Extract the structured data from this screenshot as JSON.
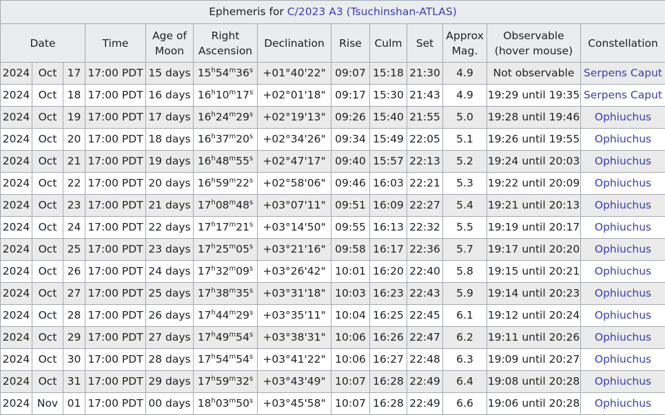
{
  "caption": {
    "prefix": "Ephemeris for ",
    "link": "C/2023 A3 (Tsuchinshan-ATLAS)"
  },
  "headers": {
    "date": "Date",
    "time": "Time",
    "age": [
      "Age of",
      "Moon"
    ],
    "ra": [
      "Right",
      "Ascension"
    ],
    "dec": "Declination",
    "rise": "Rise",
    "culm": "Culm",
    "set": "Set",
    "mag": [
      "Approx",
      "Mag."
    ],
    "obs": [
      "Observable",
      "(hover mouse)"
    ],
    "constellation": "Constellation"
  },
  "rows": [
    {
      "year": "2024",
      "month": "Oct",
      "day": "17",
      "time": "17:00 PDT",
      "age": "15 days",
      "ra": [
        "15",
        "54",
        "36"
      ],
      "dec": "+01°40'22\"",
      "rise": "09:07",
      "culm": "15:18",
      "set": "21:30",
      "mag": "4.9",
      "obs": "Not observable",
      "constellation": "Serpens Caput"
    },
    {
      "year": "2024",
      "month": "Oct",
      "day": "18",
      "time": "17:00 PDT",
      "age": "16 days",
      "ra": [
        "16",
        "10",
        "17"
      ],
      "dec": "+02°01'18\"",
      "rise": "09:17",
      "culm": "15:30",
      "set": "21:43",
      "mag": "4.9",
      "obs": "19:29 until 19:35",
      "constellation": "Serpens Caput"
    },
    {
      "year": "2024",
      "month": "Oct",
      "day": "19",
      "time": "17:00 PDT",
      "age": "17 days",
      "ra": [
        "16",
        "24",
        "29"
      ],
      "dec": "+02°19'13\"",
      "rise": "09:26",
      "culm": "15:40",
      "set": "21:55",
      "mag": "5.0",
      "obs": "19:28 until 19:46",
      "constellation": "Ophiuchus"
    },
    {
      "year": "2024",
      "month": "Oct",
      "day": "20",
      "time": "17:00 PDT",
      "age": "18 days",
      "ra": [
        "16",
        "37",
        "20"
      ],
      "dec": "+02°34'26\"",
      "rise": "09:34",
      "culm": "15:49",
      "set": "22:05",
      "mag": "5.1",
      "obs": "19:26 until 19:55",
      "constellation": "Ophiuchus"
    },
    {
      "year": "2024",
      "month": "Oct",
      "day": "21",
      "time": "17:00 PDT",
      "age": "19 days",
      "ra": [
        "16",
        "48",
        "55"
      ],
      "dec": "+02°47'17\"",
      "rise": "09:40",
      "culm": "15:57",
      "set": "22:13",
      "mag": "5.2",
      "obs": "19:24 until 20:03",
      "constellation": "Ophiuchus"
    },
    {
      "year": "2024",
      "month": "Oct",
      "day": "22",
      "time": "17:00 PDT",
      "age": "20 days",
      "ra": [
        "16",
        "59",
        "22"
      ],
      "dec": "+02°58'06\"",
      "rise": "09:46",
      "culm": "16:03",
      "set": "22:21",
      "mag": "5.3",
      "obs": "19:22 until 20:09",
      "constellation": "Ophiuchus"
    },
    {
      "year": "2024",
      "month": "Oct",
      "day": "23",
      "time": "17:00 PDT",
      "age": "21 days",
      "ra": [
        "17",
        "08",
        "48"
      ],
      "dec": "+03°07'11\"",
      "rise": "09:51",
      "culm": "16:09",
      "set": "22:27",
      "mag": "5.4",
      "obs": "19:21 until 20:13",
      "constellation": "Ophiuchus"
    },
    {
      "year": "2024",
      "month": "Oct",
      "day": "24",
      "time": "17:00 PDT",
      "age": "22 days",
      "ra": [
        "17",
        "17",
        "21"
      ],
      "dec": "+03°14'50\"",
      "rise": "09:55",
      "culm": "16:13",
      "set": "22:32",
      "mag": "5.5",
      "obs": "19:19 until 20:17",
      "constellation": "Ophiuchus"
    },
    {
      "year": "2024",
      "month": "Oct",
      "day": "25",
      "time": "17:00 PDT",
      "age": "23 days",
      "ra": [
        "17",
        "25",
        "05"
      ],
      "dec": "+03°21'16\"",
      "rise": "09:58",
      "culm": "16:17",
      "set": "22:36",
      "mag": "5.7",
      "obs": "19:17 until 20:20",
      "constellation": "Ophiuchus"
    },
    {
      "year": "2024",
      "month": "Oct",
      "day": "26",
      "time": "17:00 PDT",
      "age": "24 days",
      "ra": [
        "17",
        "32",
        "09"
      ],
      "dec": "+03°26'42\"",
      "rise": "10:01",
      "culm": "16:20",
      "set": "22:40",
      "mag": "5.8",
      "obs": "19:15 until 20:21",
      "constellation": "Ophiuchus"
    },
    {
      "year": "2024",
      "month": "Oct",
      "day": "27",
      "time": "17:00 PDT",
      "age": "25 days",
      "ra": [
        "17",
        "38",
        "35"
      ],
      "dec": "+03°31'18\"",
      "rise": "10:03",
      "culm": "16:23",
      "set": "22:43",
      "mag": "5.9",
      "obs": "19:14 until 20:23",
      "constellation": "Ophiuchus"
    },
    {
      "year": "2024",
      "month": "Oct",
      "day": "28",
      "time": "17:00 PDT",
      "age": "26 days",
      "ra": [
        "17",
        "44",
        "29"
      ],
      "dec": "+03°35'11\"",
      "rise": "10:04",
      "culm": "16:25",
      "set": "22:45",
      "mag": "6.1",
      "obs": "19:12 until 20:24",
      "constellation": "Ophiuchus"
    },
    {
      "year": "2024",
      "month": "Oct",
      "day": "29",
      "time": "17:00 PDT",
      "age": "27 days",
      "ra": [
        "17",
        "49",
        "54"
      ],
      "dec": "+03°38'31\"",
      "rise": "10:06",
      "culm": "16:26",
      "set": "22:47",
      "mag": "6.2",
      "obs": "19:11 until 20:26",
      "constellation": "Ophiuchus"
    },
    {
      "year": "2024",
      "month": "Oct",
      "day": "30",
      "time": "17:00 PDT",
      "age": "28 days",
      "ra": [
        "17",
        "54",
        "54"
      ],
      "dec": "+03°41'22\"",
      "rise": "10:06",
      "culm": "16:27",
      "set": "22:48",
      "mag": "6.3",
      "obs": "19:09 until 20:27",
      "constellation": "Ophiuchus"
    },
    {
      "year": "2024",
      "month": "Oct",
      "day": "31",
      "time": "17:00 PDT",
      "age": "29 days",
      "ra": [
        "17",
        "59",
        "32"
      ],
      "dec": "+03°43'49\"",
      "rise": "10:07",
      "culm": "16:28",
      "set": "22:49",
      "mag": "6.4",
      "obs": "19:08 until 20:28",
      "constellation": "Ophiuchus"
    },
    {
      "year": "2024",
      "month": "Nov",
      "day": "01",
      "time": "17:00 PDT",
      "age": "00 days",
      "ra": [
        "18",
        "03",
        "50"
      ],
      "dec": "+03°45'58\"",
      "rise": "10:07",
      "culm": "16:28",
      "set": "22:49",
      "mag": "6.6",
      "obs": "19:06 until 20:28",
      "constellation": "Ophiuchus"
    }
  ],
  "colors": {
    "link": "#3a3db5",
    "header_bg": "#eaecf0",
    "stripe": "#ebebeb",
    "border": "#a2a9b1"
  }
}
